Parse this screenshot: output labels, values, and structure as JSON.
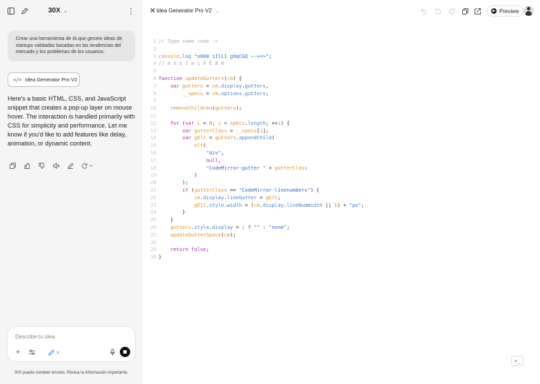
{
  "sidebar": {
    "brand": "30X",
    "user_message": "Crear una herramienta de IA que genere ideas de startups validadas basadas en las tendencias del mercado y los problemas de los usuarios.",
    "artifact_button_label": "Idea Generator Pro V2",
    "assistant_message": "Here's a basic HTML, CSS, and JavaScript snippet that creates a pop-up layer on mouse hover. The interaction is handled primarily with CSS for simplicity and performance. Let me know if you'd like to add features like delay, animation, or dynamic content.",
    "composer_placeholder": "Describe tu idea",
    "disclaimer": "30X puede cometer errores. Revisa la información importante."
  },
  "editor": {
    "title": "Idea Generator Pro V2",
    "preview_label": "Preview",
    "terminal_label": ">_"
  },
  "code": {
    "lines": [
      {
        "n": "1",
        "tokens": [
          {
            "c": "c-comment",
            "t": "// Type some code ->"
          }
        ]
      },
      {
        "n": "2",
        "tokens": []
      },
      {
        "n": "3",
        "tokens": [
          {
            "c": "c-fn",
            "t": "console"
          },
          {
            "c": "c-def",
            "t": "."
          },
          {
            "c": "c-prop",
            "t": "log"
          },
          {
            "c": "c-def",
            "t": " "
          },
          {
            "c": "c-str",
            "t": "\"oO08 iIlL1 g9qCGQ ~-+=>\""
          },
          {
            "c": "c-def",
            "t": ";"
          }
        ]
      },
      {
        "n": "4",
        "tokens": [
          {
            "c": "c-comment",
            "t": "// â é ù ï ø ç Ã Ē Æ œ"
          }
        ]
      },
      {
        "n": "5",
        "tokens": []
      },
      {
        "n": "6",
        "tokens": [
          {
            "c": "c-kw",
            "t": "function"
          },
          {
            "c": "c-def",
            "t": " "
          },
          {
            "c": "c-fn",
            "t": "updateGutters"
          },
          {
            "c": "c-def",
            "t": "("
          },
          {
            "c": "c-fn",
            "t": "cm"
          },
          {
            "c": "c-def",
            "t": ") {"
          }
        ]
      },
      {
        "n": "7",
        "tokens": [
          {
            "c": "c-def",
            "t": "    "
          },
          {
            "c": "c-kw",
            "t": "var"
          },
          {
            "c": "c-def",
            "t": " "
          },
          {
            "c": "c-fn",
            "t": "gutters"
          },
          {
            "c": "c-def",
            "t": " = "
          },
          {
            "c": "c-fn",
            "t": "cm"
          },
          {
            "c": "c-def",
            "t": "."
          },
          {
            "c": "c-prop",
            "t": "display"
          },
          {
            "c": "c-def",
            "t": "."
          },
          {
            "c": "c-prop",
            "t": "gutters"
          },
          {
            "c": "c-def",
            "t": ","
          }
        ]
      },
      {
        "n": "8",
        "tokens": [
          {
            "c": "c-def",
            "t": "        "
          },
          {
            "c": "c-fn",
            "t": "__specs"
          },
          {
            "c": "c-def",
            "t": " = "
          },
          {
            "c": "c-fn",
            "t": "cm"
          },
          {
            "c": "c-def",
            "t": "."
          },
          {
            "c": "c-prop",
            "t": "options"
          },
          {
            "c": "c-def",
            "t": "."
          },
          {
            "c": "c-prop",
            "t": "gutters"
          },
          {
            "c": "c-def",
            "t": ";"
          }
        ]
      },
      {
        "n": "9",
        "tokens": []
      },
      {
        "n": "10",
        "tokens": [
          {
            "c": "c-def",
            "t": "    "
          },
          {
            "c": "c-fn",
            "t": "removeChildren"
          },
          {
            "c": "c-def",
            "t": "("
          },
          {
            "c": "c-fn",
            "t": "gutters"
          },
          {
            "c": "c-def",
            "t": ");"
          }
        ]
      },
      {
        "n": "11",
        "tokens": []
      },
      {
        "n": "12",
        "tokens": [
          {
            "c": "c-def",
            "t": "    "
          },
          {
            "c": "c-kw",
            "t": "for"
          },
          {
            "c": "c-def",
            "t": " ("
          },
          {
            "c": "c-kw",
            "t": "var"
          },
          {
            "c": "c-def",
            "t": " "
          },
          {
            "c": "c-fn",
            "t": "i"
          },
          {
            "c": "c-def",
            "t": " = "
          },
          {
            "c": "c-num",
            "t": "0"
          },
          {
            "c": "c-def",
            "t": "; "
          },
          {
            "c": "c-fn",
            "t": "i"
          },
          {
            "c": "c-def",
            "t": " < "
          },
          {
            "c": "c-fn",
            "t": "specs"
          },
          {
            "c": "c-def",
            "t": "."
          },
          {
            "c": "c-prop",
            "t": "length"
          },
          {
            "c": "c-def",
            "t": "; ++"
          },
          {
            "c": "c-fn",
            "t": "i"
          },
          {
            "c": "c-def",
            "t": ") {"
          }
        ]
      },
      {
        "n": "13",
        "tokens": [
          {
            "c": "c-def",
            "t": "        "
          },
          {
            "c": "c-kw",
            "t": "var"
          },
          {
            "c": "c-def",
            "t": " "
          },
          {
            "c": "c-fn",
            "t": "gutterClass"
          },
          {
            "c": "c-def",
            "t": " = "
          },
          {
            "c": "c-fn",
            "t": "__specs"
          },
          {
            "c": "c-def",
            "t": "["
          },
          {
            "c": "c-fn",
            "t": "i"
          },
          {
            "c": "c-def",
            "t": "];"
          }
        ]
      },
      {
        "n": "14",
        "tokens": [
          {
            "c": "c-def",
            "t": "        "
          },
          {
            "c": "c-kw",
            "t": "var"
          },
          {
            "c": "c-def",
            "t": " "
          },
          {
            "c": "c-fn",
            "t": "gElt"
          },
          {
            "c": "c-def",
            "t": " = "
          },
          {
            "c": "c-fn",
            "t": "gutters"
          },
          {
            "c": "c-def",
            "t": "."
          },
          {
            "c": "c-prop",
            "t": "appendChild"
          },
          {
            "c": "c-def",
            "t": "("
          }
        ]
      },
      {
        "n": "15",
        "tokens": [
          {
            "c": "c-def",
            "t": "            "
          },
          {
            "c": "c-fn",
            "t": "elt"
          },
          {
            "c": "c-def",
            "t": "("
          }
        ]
      },
      {
        "n": "16",
        "tokens": [
          {
            "c": "c-def",
            "t": "                "
          },
          {
            "c": "c-str",
            "t": "\"div\""
          },
          {
            "c": "c-def",
            "t": ","
          }
        ]
      },
      {
        "n": "17",
        "tokens": [
          {
            "c": "c-def",
            "t": "                "
          },
          {
            "c": "c-kw",
            "t": "null"
          },
          {
            "c": "c-def",
            "t": ","
          }
        ]
      },
      {
        "n": "18",
        "tokens": [
          {
            "c": "c-def",
            "t": "                "
          },
          {
            "c": "c-str",
            "t": "\"CodeMirror-gutter \""
          },
          {
            "c": "c-def",
            "t": " + "
          },
          {
            "c": "c-fn",
            "t": "gutterClass"
          }
        ]
      },
      {
        "n": "19",
        "tokens": [
          {
            "c": "c-def",
            "t": "            )"
          }
        ]
      },
      {
        "n": "20",
        "tokens": [
          {
            "c": "c-def",
            "t": "        );"
          }
        ]
      },
      {
        "n": "21",
        "tokens": [
          {
            "c": "c-def",
            "t": "        "
          },
          {
            "c": "c-kw",
            "t": "if"
          },
          {
            "c": "c-def",
            "t": " ("
          },
          {
            "c": "c-fn",
            "t": "gutterClass"
          },
          {
            "c": "c-def",
            "t": " == "
          },
          {
            "c": "c-str",
            "t": "\"CodeMirror-linenumbers\""
          },
          {
            "c": "c-def",
            "t": ") {"
          }
        ]
      },
      {
        "n": "22",
        "tokens": [
          {
            "c": "c-def",
            "t": "            "
          },
          {
            "c": "c-fn",
            "t": "cm"
          },
          {
            "c": "c-def",
            "t": "."
          },
          {
            "c": "c-prop",
            "t": "display"
          },
          {
            "c": "c-def",
            "t": "."
          },
          {
            "c": "c-prop",
            "t": "lineGutter"
          },
          {
            "c": "c-def",
            "t": " = "
          },
          {
            "c": "c-fn",
            "t": "gElt"
          },
          {
            "c": "c-def",
            "t": ";"
          }
        ]
      },
      {
        "n": "23",
        "tokens": [
          {
            "c": "c-def",
            "t": "            "
          },
          {
            "c": "c-fn",
            "t": "gElt"
          },
          {
            "c": "c-def",
            "t": "."
          },
          {
            "c": "c-prop",
            "t": "style"
          },
          {
            "c": "c-def",
            "t": "."
          },
          {
            "c": "c-prop",
            "t": "width"
          },
          {
            "c": "c-def",
            "t": " = ("
          },
          {
            "c": "c-fn",
            "t": "cm"
          },
          {
            "c": "c-def",
            "t": "."
          },
          {
            "c": "c-prop",
            "t": "display"
          },
          {
            "c": "c-def",
            "t": "."
          },
          {
            "c": "c-prop",
            "t": "lineNumWidth"
          },
          {
            "c": "c-def",
            "t": " || "
          },
          {
            "c": "c-num",
            "t": "1"
          },
          {
            "c": "c-def",
            "t": ") + "
          },
          {
            "c": "c-str",
            "t": "\"px\""
          },
          {
            "c": "c-def",
            "t": ";"
          }
        ]
      },
      {
        "n": "24",
        "tokens": [
          {
            "c": "c-def",
            "t": "        }"
          }
        ]
      },
      {
        "n": "25",
        "tokens": [
          {
            "c": "c-def",
            "t": "    }"
          }
        ]
      },
      {
        "n": "26",
        "tokens": [
          {
            "c": "c-def",
            "t": "    "
          },
          {
            "c": "c-fn",
            "t": "gutters"
          },
          {
            "c": "c-def",
            "t": "."
          },
          {
            "c": "c-prop",
            "t": "style"
          },
          {
            "c": "c-def",
            "t": "."
          },
          {
            "c": "c-prop",
            "t": "display"
          },
          {
            "c": "c-def",
            "t": " = "
          },
          {
            "c": "c-fn",
            "t": "i"
          },
          {
            "c": "c-def",
            "t": " ? "
          },
          {
            "c": "c-str",
            "t": "\"\""
          },
          {
            "c": "c-def",
            "t": " : "
          },
          {
            "c": "c-str",
            "t": "\"none\""
          },
          {
            "c": "c-def",
            "t": ";"
          }
        ]
      },
      {
        "n": "27",
        "tokens": [
          {
            "c": "c-def",
            "t": "    "
          },
          {
            "c": "c-fn",
            "t": "updateGutterSpace"
          },
          {
            "c": "c-def",
            "t": "("
          },
          {
            "c": "c-fn",
            "t": "cm"
          },
          {
            "c": "c-def",
            "t": ");"
          }
        ]
      },
      {
        "n": "28",
        "tokens": []
      },
      {
        "n": "29",
        "tokens": [
          {
            "c": "c-def",
            "t": "    "
          },
          {
            "c": "c-kw",
            "t": "return"
          },
          {
            "c": "c-def",
            "t": " "
          },
          {
            "c": "c-kw",
            "t": "false"
          },
          {
            "c": "c-def",
            "t": ";"
          }
        ]
      },
      {
        "n": "30",
        "tokens": [
          {
            "c": "c-def",
            "t": "}"
          }
        ]
      }
    ]
  }
}
